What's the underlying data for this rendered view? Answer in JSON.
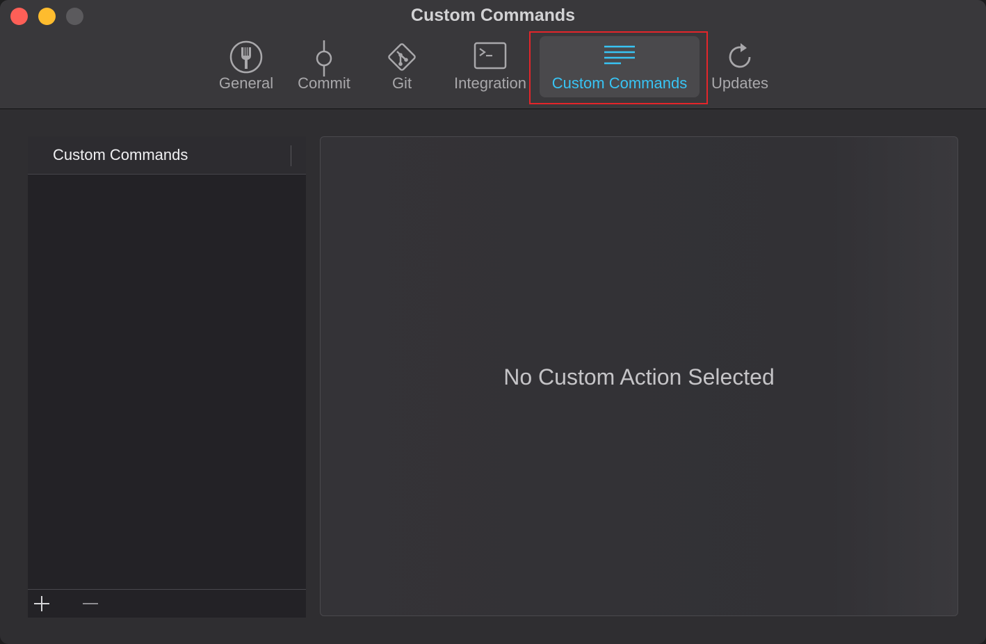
{
  "window": {
    "title": "Custom Commands"
  },
  "toolbar": {
    "tabs": [
      {
        "label": "General",
        "icon": "fork-icon",
        "active": false
      },
      {
        "label": "Commit",
        "icon": "commit-icon",
        "active": false
      },
      {
        "label": "Git",
        "icon": "git-icon",
        "active": false
      },
      {
        "label": "Integration",
        "icon": "terminal-icon",
        "active": false
      },
      {
        "label": "Custom Commands",
        "icon": "lines-icon",
        "active": true
      },
      {
        "label": "Updates",
        "icon": "refresh-icon",
        "active": false
      }
    ]
  },
  "sidebar": {
    "header": "Custom Commands",
    "add_icon": "plus-icon",
    "remove_icon": "minus-icon"
  },
  "detail": {
    "empty_message": "No Custom Action Selected"
  },
  "colors": {
    "accent": "#38c4f4",
    "highlight": "#e4252a",
    "close": "#fe5f57",
    "minimize": "#febc2e"
  }
}
